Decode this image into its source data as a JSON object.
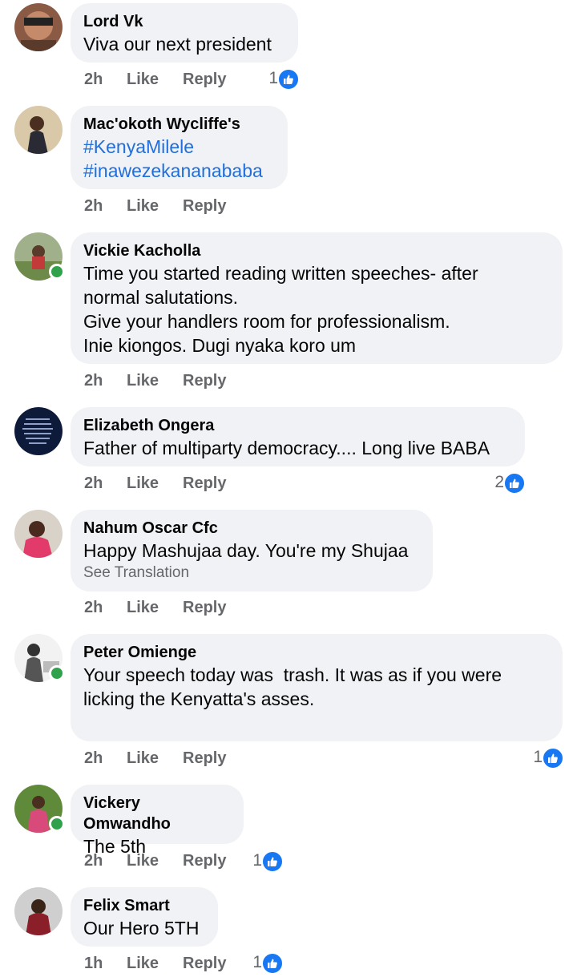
{
  "actions": {
    "like": "Like",
    "reply": "Reply"
  },
  "comments": [
    {
      "name": "Lord Vk",
      "lines": [
        "Viva our next president"
      ],
      "time": "2h",
      "reactions": "1",
      "online": false
    },
    {
      "name": "Mac'okoth Wycliffe's",
      "tags": [
        "#KenyaMilele",
        "#inawezekananababa"
      ],
      "time": "2h",
      "online": false
    },
    {
      "name": "Vickie Kacholla",
      "lines": [
        "Time you started reading written speeches- after",
        "normal salutations.",
        "Give your handlers room for professionalism.",
        "Inie kiongos. Dugi nyaka koro um"
      ],
      "time": "2h",
      "online": true
    },
    {
      "name": "Elizabeth Ongera",
      "lines": [
        "Father of multiparty democracy.... Long live BABA"
      ],
      "time": "2h",
      "reactions": "2",
      "online": false
    },
    {
      "name": "Nahum Oscar Cfc",
      "lines": [
        "Happy Mashujaa day. You're my Shujaa"
      ],
      "see_translation": "See Translation",
      "time": "2h",
      "online": false
    },
    {
      "name": "Peter Omienge",
      "lines": [
        "Your speech today was  trash. It was as if you were",
        "licking the Kenyatta's asses."
      ],
      "time": "2h",
      "reactions": "1",
      "online": true
    },
    {
      "name": "Vickery Omwandho",
      "lines": [
        "The 5th"
      ],
      "time": "2h",
      "reactions": "1",
      "online": true
    },
    {
      "name": "Felix Smart",
      "lines": [
        "Our Hero 5TH"
      ],
      "time": "1h",
      "reactions": "1",
      "online": false
    }
  ],
  "colors": {
    "bubble": "#f0f2f5",
    "link": "#216fdb",
    "meta": "#65676b",
    "like_blue": "#1877f2",
    "online_green": "#31a24c"
  }
}
